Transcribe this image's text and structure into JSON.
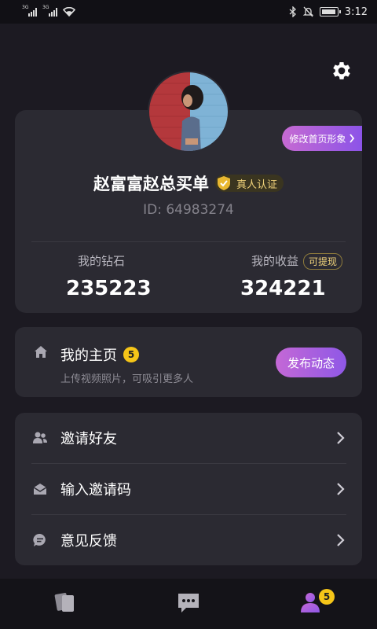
{
  "status_bar": {
    "signal1_label": "3G",
    "signal2_label": "3G",
    "time": "3:12"
  },
  "profile": {
    "edit_profile_label": "修改首页形象",
    "name": "赵富富赵总买单",
    "verified_label": "真人认证",
    "user_id": "ID: 64983274",
    "diamonds_label": "我的钻石",
    "diamonds_value": "235223",
    "earnings_label": "我的收益",
    "withdraw_label": "可提现",
    "earnings_value": "324221"
  },
  "home_section": {
    "title": "我的主页",
    "badge_count": "5",
    "subtitle": "上传视频照片，可吸引更多人",
    "publish_label": "发布动态"
  },
  "menu": [
    {
      "label": "邀请好友",
      "icon": "users-icon"
    },
    {
      "label": "输入邀请码",
      "icon": "envelope-icon"
    },
    {
      "label": "意见反馈",
      "icon": "chat-bubble-icon"
    }
  ],
  "tab_bar": {
    "tabs": [
      {
        "icon": "cards-icon",
        "active": false
      },
      {
        "icon": "messages-icon",
        "active": false
      },
      {
        "icon": "profile-icon",
        "active": true
      }
    ],
    "profile_badge": "5"
  },
  "colors": {
    "background": "#1c1a22",
    "card": "#2b2a32",
    "accent_gradient_start": "#c468d6",
    "accent_gradient_end": "#8f58e6",
    "gold": "#f5c518"
  }
}
